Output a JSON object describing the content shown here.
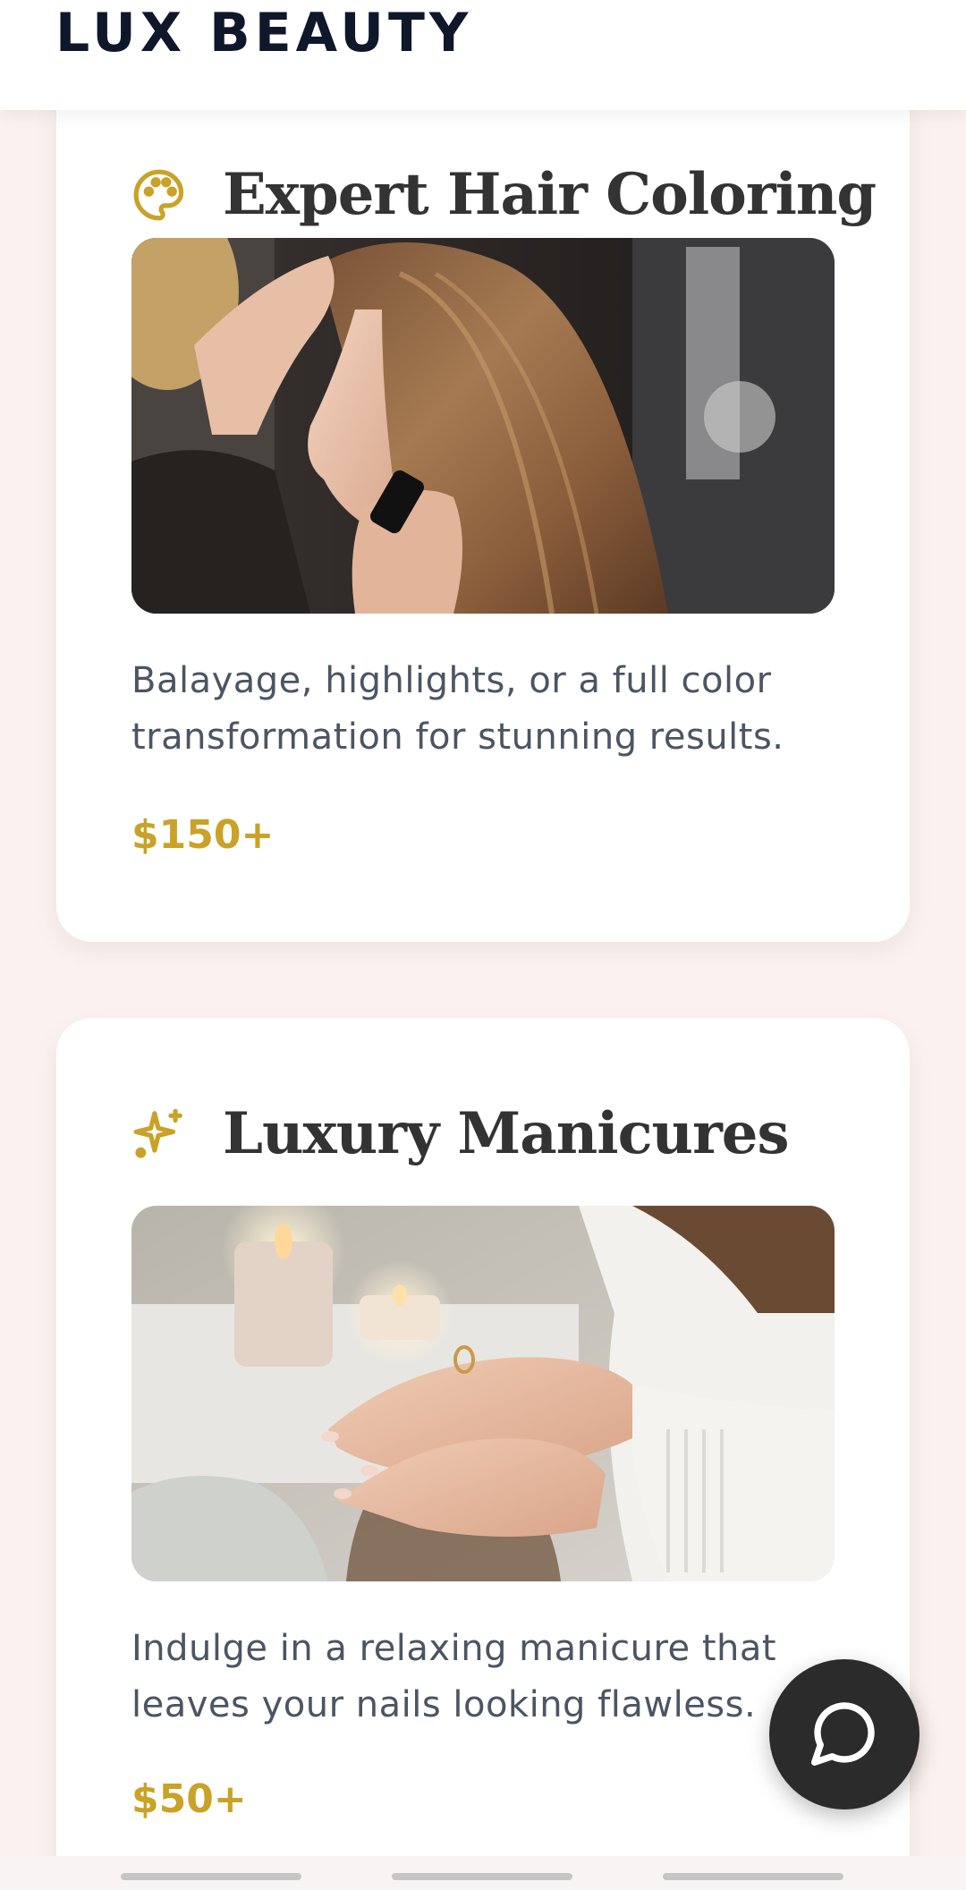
{
  "header": {
    "brand": "LUX BEAUTY"
  },
  "services": [
    {
      "icon": "palette-icon",
      "title": "Expert Hair Coloring",
      "image_alt": "Stylist applying color to long brown hair in a salon",
      "description_line1": "Balayage, highlights, or a full color",
      "description_line2": "transformation for stunning results.",
      "price": "$150+"
    },
    {
      "icon": "sparkles-icon",
      "title": "Luxury Manicures",
      "image_alt": "Hands with a fresh manicure beside lit candles",
      "description_line1": "Indulge in a relaxing manicure that",
      "description_line2": "leaves your nails looking flawless.",
      "price": "$50+"
    }
  ],
  "chat": {
    "icon": "chat-bubble-icon"
  },
  "pagination": {
    "count": 3
  },
  "colors": {
    "accent": "#c9a227",
    "heading": "#333333",
    "brand": "#0f172a",
    "background": "#fbf1ef",
    "chat_button": "#2b2b2b"
  }
}
